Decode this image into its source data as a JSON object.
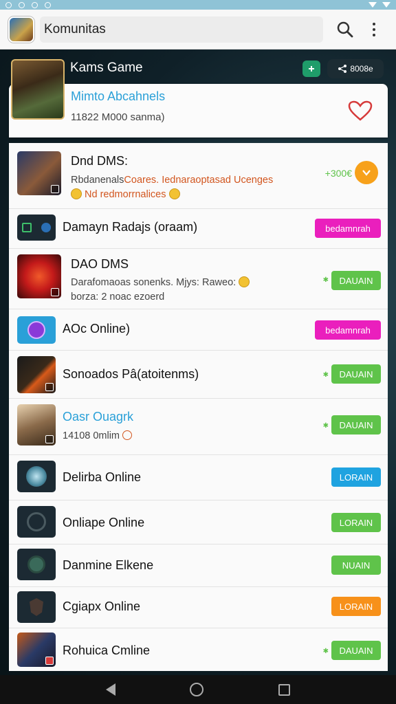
{
  "appbar": {
    "title": "Komunitas"
  },
  "hero": {
    "title": "Kams Game",
    "badge": "8008e"
  },
  "featured": {
    "title": "Mimto Abcahnels",
    "subtitle": "11822 M000 sanma)"
  },
  "rows": [
    {
      "title": "Dnd DMS:",
      "desc_plain": "Rbdanenals",
      "desc_orange": "Coares. Iednaraoptasad Ucenges",
      "desc2": "Nd redmorrnalices",
      "points": "+300€"
    },
    {
      "title": "Damayn Radajs (oraam)",
      "button": "bedamnrah"
    },
    {
      "title": "DAO DMS",
      "desc": "Darafomaoas sonenks. Mjys: Raweo:",
      "desc2": "borza: 2 noac ezoerd",
      "button": "DAUAIN"
    },
    {
      "title": "AOc Online)",
      "button": "bedamnrah"
    },
    {
      "title": "Sonoados Pâ(atoitenms)",
      "button": "DAUAIN"
    },
    {
      "title": "Oasr Ouagrk",
      "desc": "14108 0mlim",
      "button": "DAUAIN"
    },
    {
      "title": "Delirba Online",
      "button": "LORAIN"
    },
    {
      "title": "Onliape Online",
      "button": "LORAIN"
    },
    {
      "title": "Danmine Elkene",
      "button": "NUAIN"
    },
    {
      "title": "Cgiapx Online",
      "button": "LORAIN"
    },
    {
      "title": "Rohuica Cmline",
      "button": "DAUAIN"
    }
  ],
  "colors": {
    "magenta": "#ea1fbd",
    "green": "#5fc34a",
    "blue": "#1fa3e0",
    "orange": "#f7911a",
    "accent_blue": "#2aa0d8"
  }
}
